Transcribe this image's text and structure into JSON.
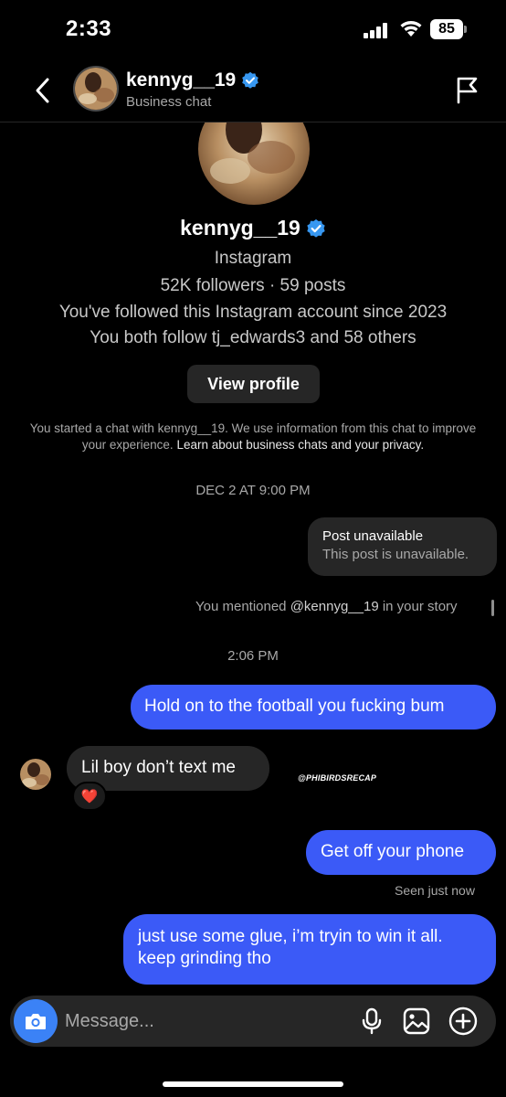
{
  "status_bar": {
    "time": "2:33",
    "battery": "85"
  },
  "header": {
    "name": "kennyg__19",
    "subtitle": "Business chat"
  },
  "profile": {
    "name": "kennyg__19",
    "platform": "Instagram",
    "stats": "52K followers · 59 posts",
    "followed_since": "You've followed this Instagram account since 2023",
    "mutuals": "You both follow tj_edwards3 and 58 others",
    "view_profile_label": "View profile"
  },
  "notice": {
    "text": "You started a chat with kennyg__19. We use information from this chat to improve your experience.",
    "link": "Learn about business chats and your privacy."
  },
  "messages": {
    "timestamp_1": "DEC 2 AT 9:00 PM",
    "shared_post": {
      "title": "Post unavailable",
      "subtitle": "This post is unavailable."
    },
    "mention": {
      "prefix": "You mentioned",
      "handle": "@kennyg__19",
      "suffix": "in your story"
    },
    "timestamp_2": "2:06 PM",
    "out_1": "Hold on to the football you fucking bum",
    "in_1": "Lil boy don’t text me",
    "reaction": "❤️",
    "watermark": "@PHIBIRDSRECAP",
    "out_2": "Get off your phone",
    "seen": "Seen just now",
    "out_3": "just use some glue, i’m tryin to win it all. keep grinding tho"
  },
  "composer": {
    "placeholder": "Message..."
  },
  "colors": {
    "outgoing": "#3b5af7",
    "incoming": "#262626",
    "verified": "#3797f0",
    "camera": "#3b82f6"
  },
  "icons": [
    "back-arrow-icon",
    "verified-badge-icon",
    "flag-icon",
    "camera-icon",
    "microphone-icon",
    "gallery-icon",
    "plus-icon"
  ]
}
